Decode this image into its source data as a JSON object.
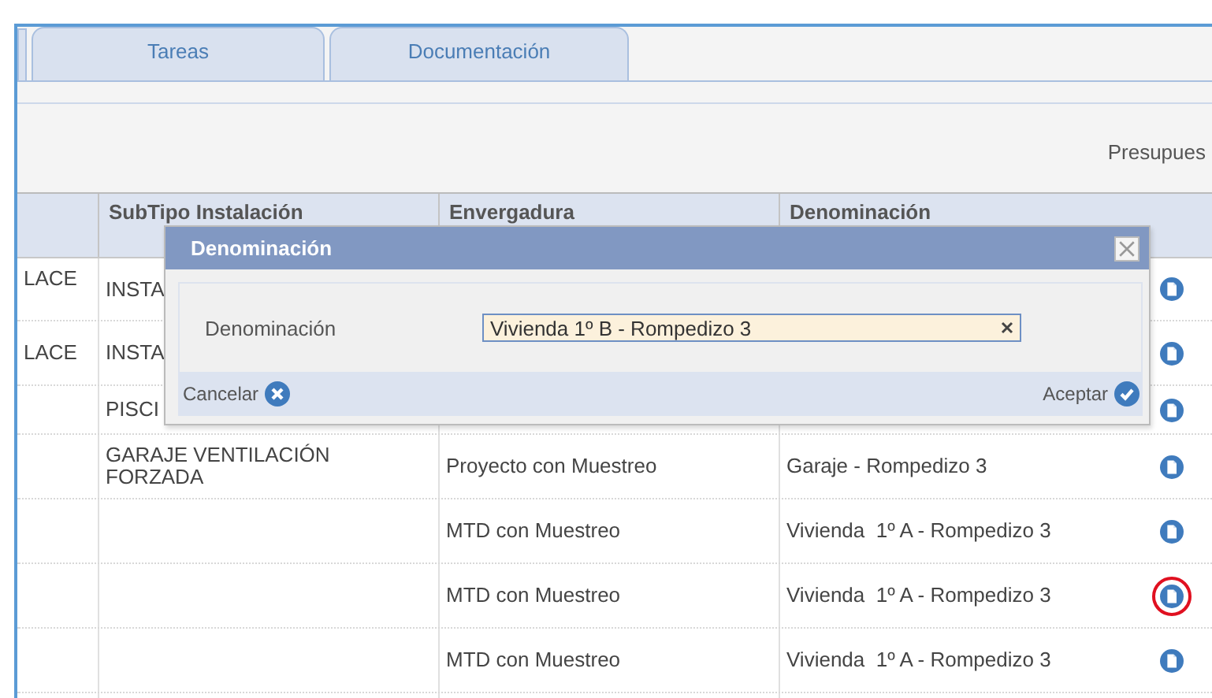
{
  "tabs": [
    {
      "label": "Tareas"
    },
    {
      "label": "Documentación"
    }
  ],
  "toolbar": {
    "label": "Presupues"
  },
  "table": {
    "columns": [
      "",
      "SubTipo Instalación",
      "Envergadura",
      "Denominación"
    ],
    "rows": [
      {
        "column_1": "LACE",
        "subtipo": "INSTA",
        "highlighted": false
      },
      {
        "column_1": "LACE",
        "subtipo": "INSTA",
        "highlighted": false
      },
      {
        "subtipo": "PISCI",
        "highlighted": false
      },
      {
        "subtipo": "GARAJE VENTILACIÓN FORZADA",
        "envergadura": "Proyecto con Muestreo",
        "denominacion": "Garaje - Rompedizo 3",
        "highlighted": false
      },
      {
        "envergadura": "MTD con Muestreo",
        "denominacion": "Vivienda  1º A - Rompedizo 3",
        "highlighted": false
      },
      {
        "envergadura": "MTD con Muestreo",
        "denominacion": "Vivienda  1º A - Rompedizo 3",
        "highlighted": true
      },
      {
        "envergadura": "MTD con Muestreo",
        "denominacion": "Vivienda  1º A - Rompedizo 3",
        "highlighted": false
      }
    ]
  },
  "dialog": {
    "title": "Denominación",
    "field_label": "Denominación",
    "value": "Vivienda 1º B - Rompedizo 3",
    "cancel": "Cancelar",
    "accept": "Aceptar"
  }
}
